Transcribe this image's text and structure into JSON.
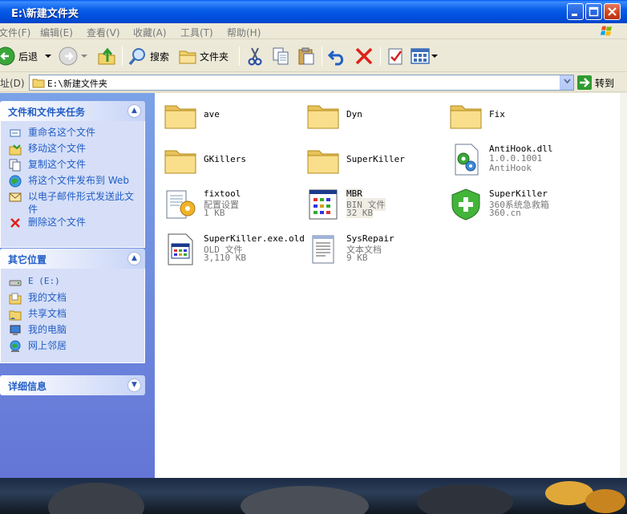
{
  "window": {
    "title": "E:\\新建文件夹"
  },
  "menu": [
    "文件(F)",
    "编辑(E)",
    "查看(V)",
    "收藏(A)",
    "工具(T)",
    "帮助(H)"
  ],
  "toolbar": {
    "back": "后退",
    "search": "搜索",
    "folders": "文件夹"
  },
  "address": {
    "label": "址(D)",
    "path": "E:\\新建文件夹",
    "go": "转到"
  },
  "tasks": {
    "file_tasks": {
      "title": "文件和文件夹任务",
      "items": [
        "重命名这个文件",
        "移动这个文件",
        "复制这个文件",
        "将这个文件发布到 Web",
        "以电子邮件形式发送此文件",
        "删除这个文件"
      ]
    },
    "other_places": {
      "title": "其它位置",
      "items": [
        "E (E:)",
        "我的文档",
        "共享文档",
        "我的电脑",
        "网上邻居"
      ]
    },
    "details": {
      "title": "详细信息"
    }
  },
  "files": [
    {
      "name": "ave",
      "kind": "folder"
    },
    {
      "name": "Dyn",
      "kind": "folder"
    },
    {
      "name": "Fix",
      "kind": "folder"
    },
    {
      "name": "GKillers",
      "kind": "folder"
    },
    {
      "name": "SuperKiller",
      "kind": "folder"
    },
    {
      "name": "AntiHook.dll",
      "line2": "1.0.0.1001",
      "line3": "AntiHook",
      "kind": "dll"
    },
    {
      "name": "fixtool",
      "line2": "配置设置",
      "line3": "1 KB",
      "kind": "ini"
    },
    {
      "name": "MBR",
      "line2": "BIN 文件",
      "line3": "32 KB",
      "kind": "bin"
    },
    {
      "name": "SuperKiller",
      "line2": "360系统急救箱",
      "line3": "360.cn",
      "kind": "exe"
    },
    {
      "name": "SuperKiller.exe.old",
      "line2": "OLD 文件",
      "line3": "3,110 KB",
      "kind": "old"
    },
    {
      "name": "SysRepair",
      "line2": "文本文档",
      "line3": "9 KB",
      "kind": "txt"
    }
  ]
}
